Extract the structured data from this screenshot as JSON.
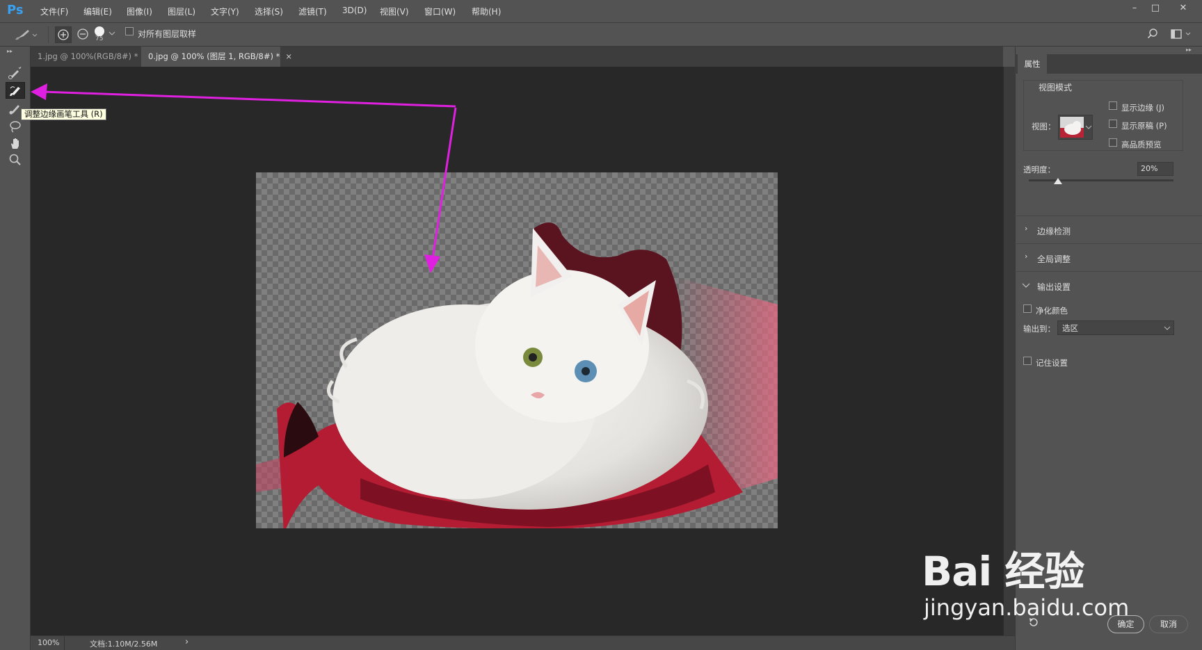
{
  "app": {
    "logo": "Ps"
  },
  "menu": {
    "items": [
      "文件(F)",
      "编辑(E)",
      "图像(I)",
      "图层(L)",
      "文字(Y)",
      "选择(S)",
      "滤镜(T)",
      "3D(D)",
      "视图(V)",
      "窗口(W)",
      "帮助(H)"
    ]
  },
  "window_controls": {
    "minimize": "–",
    "maximize": "□",
    "close": "✕"
  },
  "options": {
    "brush_size": "75",
    "sample_all_layers_label": "对所有图层取样"
  },
  "tabs": [
    {
      "label": "1.jpg @ 100%(RGB/8#) *",
      "close": "×"
    },
    {
      "label": "0.jpg @ 100% (图层 1, RGB/8#) *",
      "close": "×"
    }
  ],
  "tooltip": {
    "text": "调整边缘画笔工具 (R)"
  },
  "status": {
    "zoom": "100%",
    "doc": "文档:1.10M/2.56M",
    "arrow": "›"
  },
  "panel": {
    "tab_title": "属性",
    "view_mode": {
      "title": "视图模式",
      "view_label": "视图：",
      "show_edge": "显示边缘 (J)",
      "show_original": "显示原稿 (P)",
      "hq_preview": "高品质预览"
    },
    "opacity": {
      "label": "透明度：",
      "value": "20%",
      "level": 0.2
    },
    "sections": [
      "边缘检测",
      "全局调整",
      "输出设置"
    ],
    "output": {
      "decontaminate": "净化颜色",
      "output_to_label": "输出到：",
      "output_to_value": "选区"
    },
    "remember": "记住设置",
    "ok": "确定",
    "cancel": "取消"
  },
  "watermark": {
    "main": "Bai 经验",
    "sub": "jingyan.baidu.com"
  },
  "colors": {
    "annotation_arrow": "#e020e0",
    "accent_ps": "#3aa0f0"
  }
}
